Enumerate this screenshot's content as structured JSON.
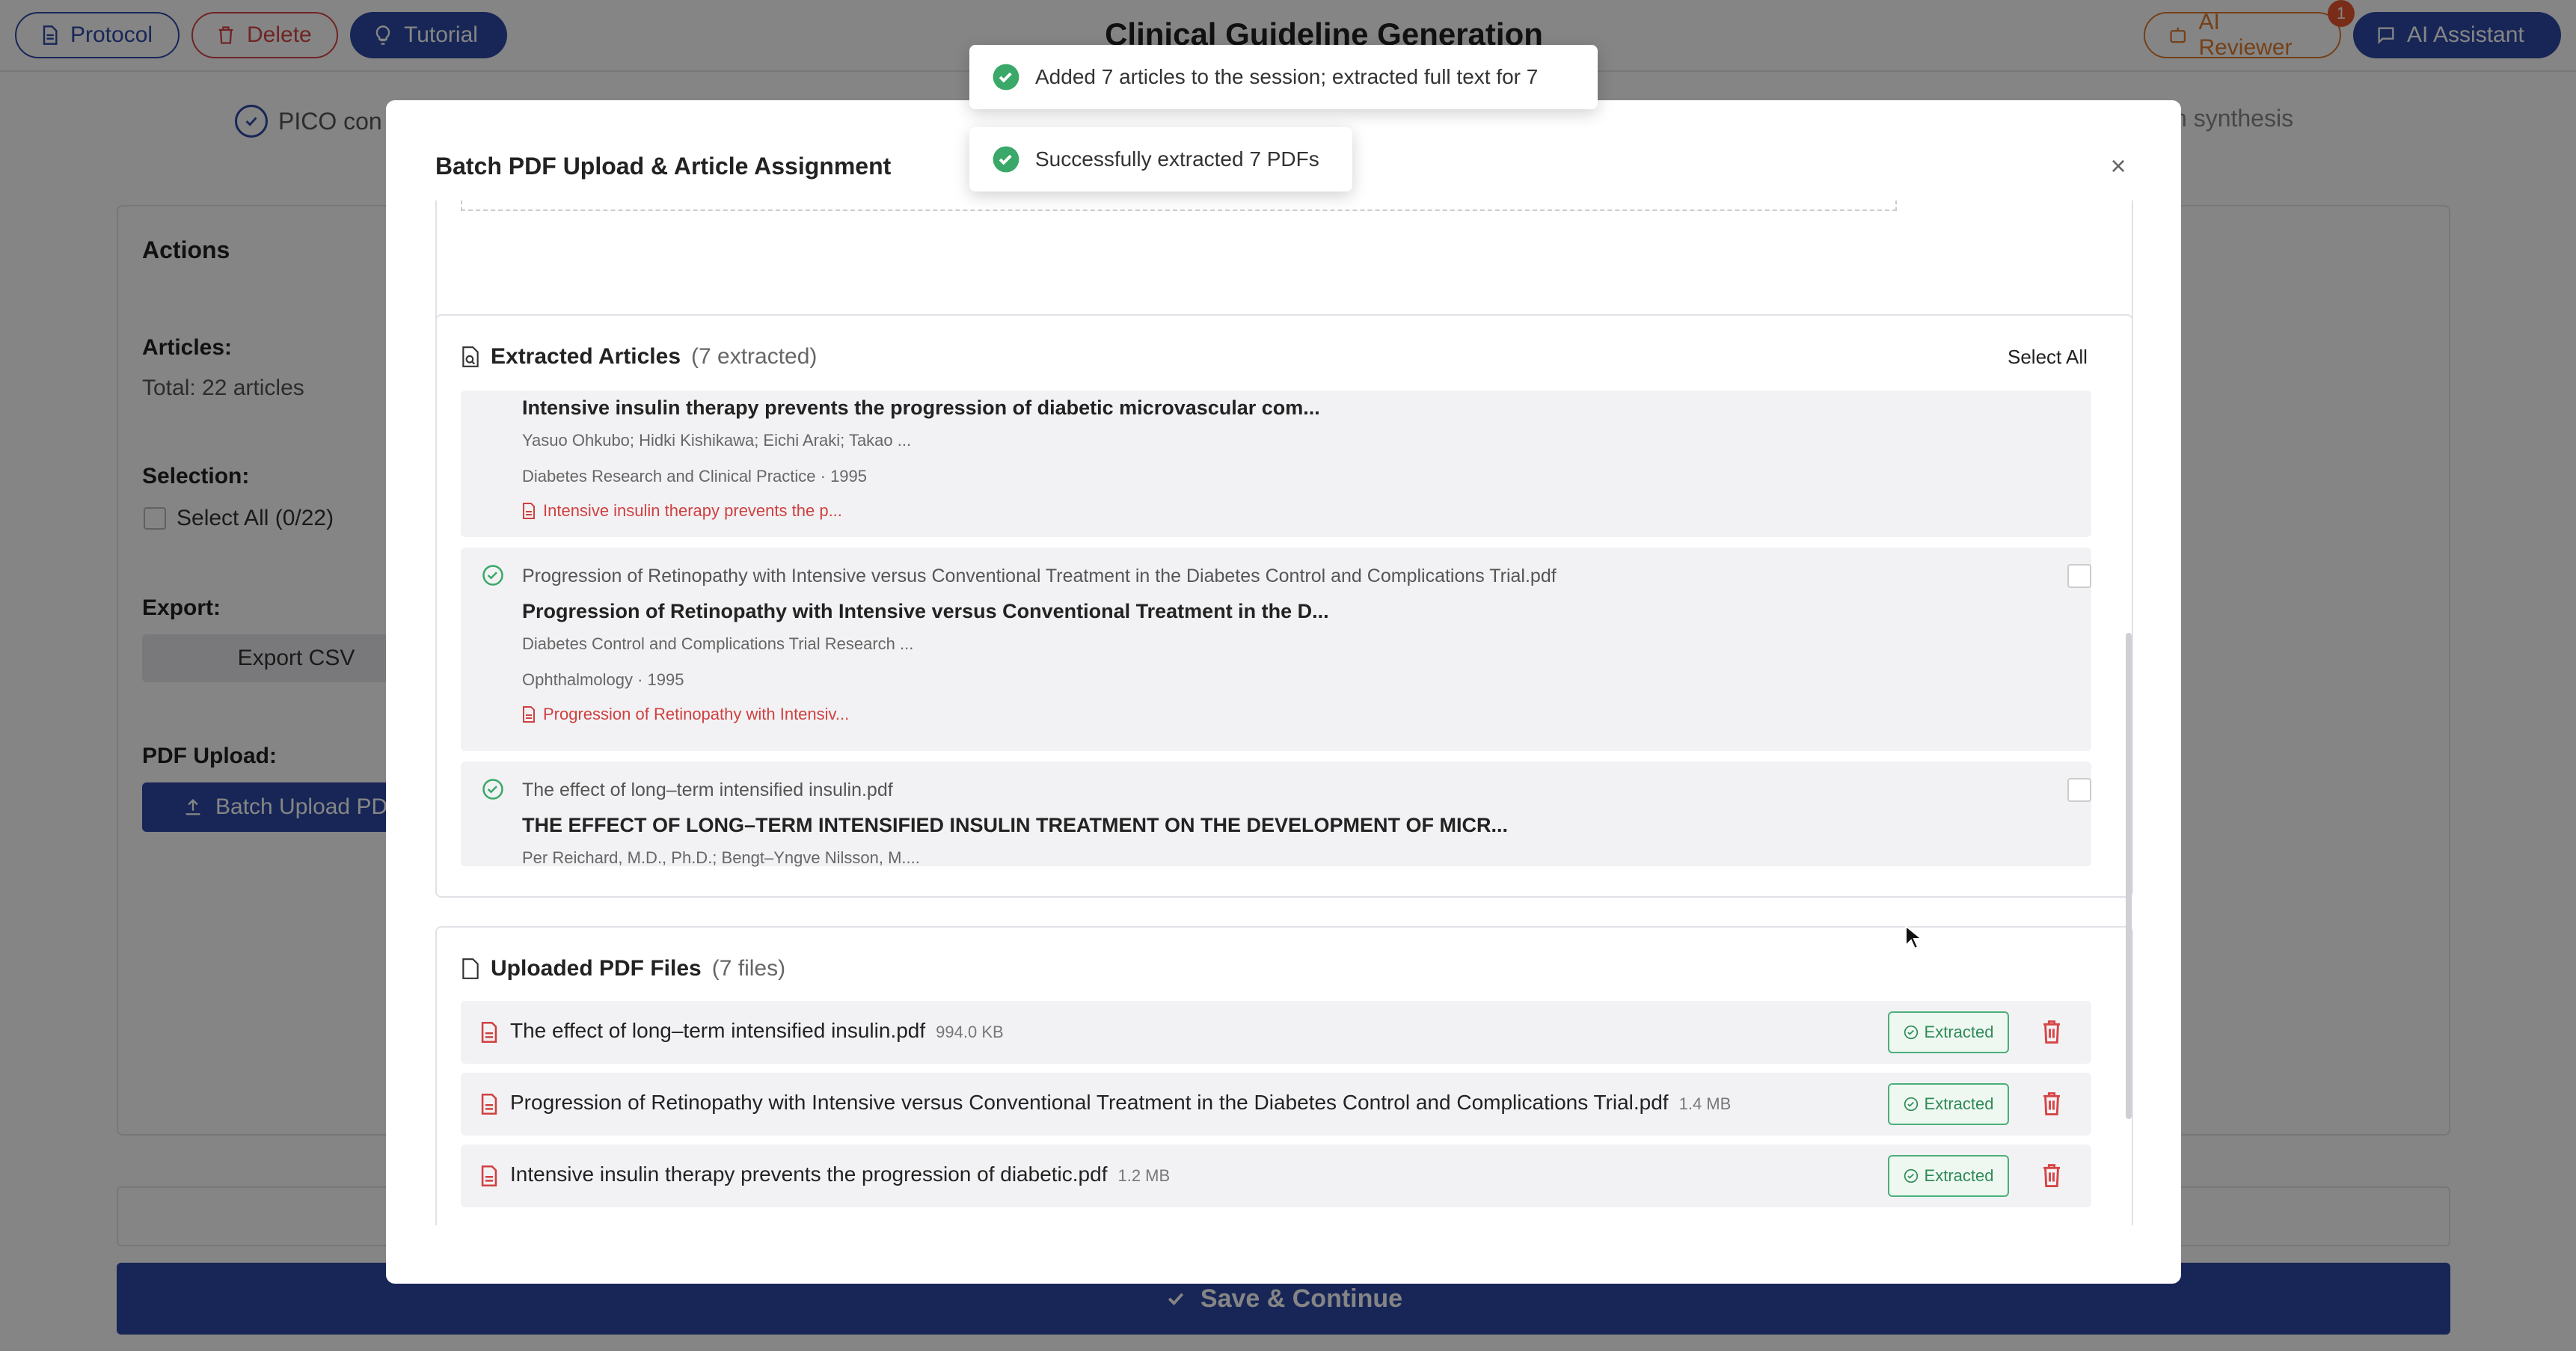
{
  "app": {
    "title": "Clinical Guideline Generation",
    "buttons": {
      "protocol": "Protocol",
      "delete": "Delete",
      "tutorial": "Tutorial",
      "ai_reviewer": "AI Reviewer",
      "ai_assistant": "AI Assistant"
    },
    "reviewer_badge": "1",
    "steps": {
      "pico": "PICO con",
      "synthesis": "n synthesis"
    }
  },
  "actions": {
    "title": "Actions",
    "articles_label": "Articles:",
    "articles_total": "Total: 22 articles",
    "selection_label": "Selection:",
    "select_all": "Select All (0/22)",
    "export_label": "Export:",
    "export_csv": "Export CSV",
    "pdf_label": "PDF Upload:",
    "batch_upload": "Batch Upload PD"
  },
  "save_continue": "Save & Continue",
  "modal": {
    "title": "Batch PDF Upload & Article Assignment",
    "close": "×",
    "extracted": {
      "title": "Extracted Articles",
      "count": "(7 extracted)",
      "select_all": "Select All",
      "articles": [
        {
          "file": "",
          "title": "Intensive insulin therapy prevents the progression of diabetic microvascular com...",
          "authors": "Yasuo Ohkubo; Hidki Kishikawa; Eichi Araki; Takao ...",
          "meta": "Diabetes Research and Clinical Practice · 1995",
          "link": "Intensive insulin therapy prevents the p..."
        },
        {
          "file": "Progression of Retinopathy with Intensive versus Conventional Treatment in the Diabetes Control and Complications Trial.pdf",
          "title": "Progression of Retinopathy with Intensive versus Conventional Treatment in the D...",
          "authors": "Diabetes Control and Complications Trial Research ...",
          "meta": "Ophthalmology · 1995",
          "link": "Progression of Retinopathy with Intensiv..."
        },
        {
          "file": "The effect of long–term intensified insulin.pdf",
          "title": "THE EFFECT OF LONG–TERM INTENSIFIED INSULIN TREATMENT ON THE DEVELOPMENT OF MICR...",
          "authors": "Per Reichard, M.D., Ph.D.; Bengt–Yngve Nilsson, M....",
          "meta": "",
          "link": ""
        }
      ]
    },
    "uploaded": {
      "title": "Uploaded PDF Files",
      "count": "(7 files)",
      "status_label": "Extracted",
      "files": [
        {
          "name": "The effect of long–term intensified insulin.pdf",
          "size": "994.0 KB"
        },
        {
          "name": "Progression of Retinopathy with Intensive versus Conventional Treatment in the Diabetes Control and Complications Trial.pdf",
          "size": "1.4 MB"
        },
        {
          "name": "Intensive insulin therapy prevents the progression of diabetic.pdf",
          "size": "1.2 MB"
        }
      ]
    }
  },
  "toasts": [
    "Added 7 articles to the session; extracted full text for 7",
    "Successfully extracted 7 PDFs"
  ],
  "colors": {
    "primary": "#2c4aa6",
    "danger": "#d64545",
    "warning": "#e07b2c",
    "success": "#3aa868"
  }
}
